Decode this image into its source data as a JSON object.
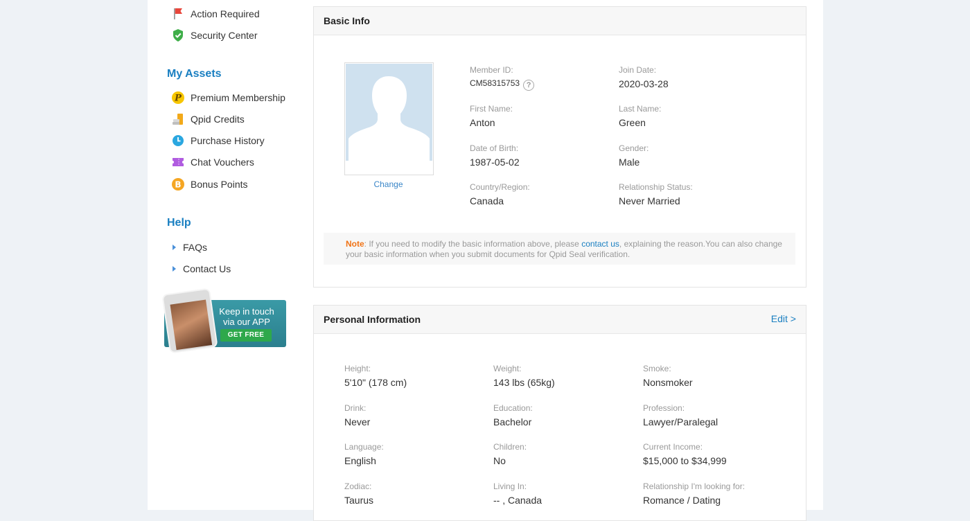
{
  "sidebar": {
    "account_items": [
      {
        "label": "Action Required",
        "icon": "flag-icon"
      },
      {
        "label": "Security Center",
        "icon": "shield-check-icon"
      }
    ],
    "assets_heading": "My Assets",
    "assets_items": [
      {
        "label": "Premium Membership",
        "icon": "premium-p-icon"
      },
      {
        "label": "Qpid Credits",
        "icon": "credits-icon"
      },
      {
        "label": "Purchase History",
        "icon": "clock-icon"
      },
      {
        "label": "Chat Vouchers",
        "icon": "voucher-icon"
      },
      {
        "label": "Bonus Points",
        "icon": "bonus-b-icon"
      }
    ],
    "help_heading": "Help",
    "help_items": [
      {
        "label": "FAQs"
      },
      {
        "label": "Contact Us"
      }
    ],
    "app_banner": {
      "line1": "Keep in touch",
      "line2": "via our APP",
      "button": "GET FREE"
    }
  },
  "basic_info": {
    "title": "Basic Info",
    "change_label": "Change",
    "fields": {
      "member_id": {
        "label": "Member ID:",
        "value": "CM58315753"
      },
      "join_date": {
        "label": "Join Date:",
        "value": "2020-03-28"
      },
      "first_name": {
        "label": "First Name:",
        "value": "Anton"
      },
      "last_name": {
        "label": "Last Name:",
        "value": "Green"
      },
      "dob": {
        "label": "Date of Birth:",
        "value": "1987-05-02"
      },
      "gender": {
        "label": "Gender:",
        "value": "Male"
      },
      "country": {
        "label": "Country/Region:",
        "value": "Canada"
      },
      "relationship": {
        "label": "Relationship Status:",
        "value": "Never Married"
      }
    },
    "note": {
      "label": "Note",
      "text_before": ": If you need to modify the basic information above, please ",
      "link": "contact us",
      "text_after": ", explaining the reason.You can also change your basic information when you submit documents for Qpid Seal verification."
    }
  },
  "personal_info": {
    "title": "Personal Information",
    "edit_label": "Edit >",
    "fields": {
      "height": {
        "label": "Height:",
        "value": "5'10\" (178 cm)"
      },
      "weight": {
        "label": "Weight:",
        "value": "143 lbs (65kg)"
      },
      "smoke": {
        "label": "Smoke:",
        "value": "Nonsmoker"
      },
      "drink": {
        "label": "Drink:",
        "value": "Never"
      },
      "education": {
        "label": "Education:",
        "value": "Bachelor"
      },
      "profession": {
        "label": "Profession:",
        "value": "Lawyer/Paralegal"
      },
      "language": {
        "label": "Language:",
        "value": "English"
      },
      "children": {
        "label": "Children:",
        "value": "No"
      },
      "income": {
        "label": "Current Income:",
        "value": "$15,000 to $34,999"
      },
      "zodiac": {
        "label": "Zodiac:",
        "value": "Taurus"
      },
      "living_in": {
        "label": "Living In:",
        "value": "-- , Canada"
      },
      "looking_for": {
        "label": "Relationship I'm looking for:",
        "value": "Romance / Dating"
      }
    }
  },
  "colors": {
    "accent_blue": "#1a7fc1",
    "note_orange": "#f07316",
    "page_bg": "#eef2f6"
  }
}
